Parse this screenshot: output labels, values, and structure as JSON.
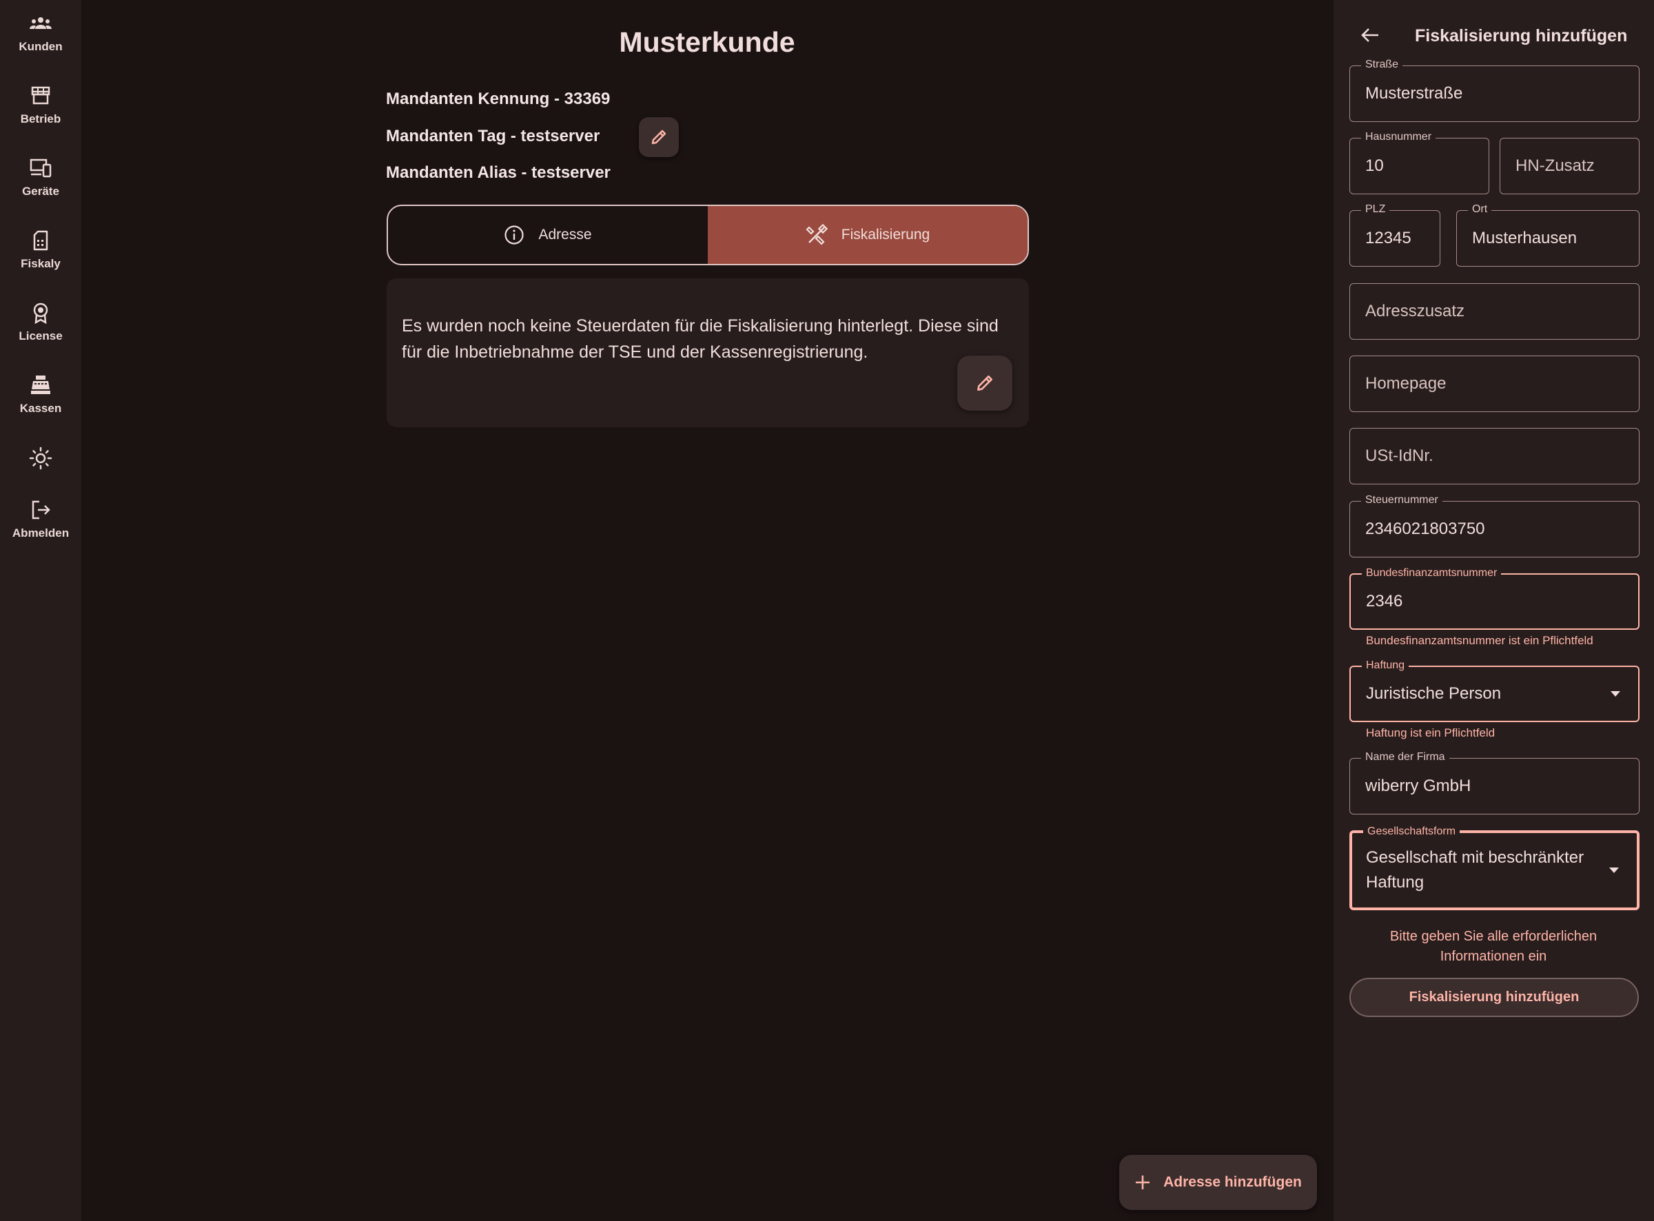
{
  "nav": {
    "items": [
      {
        "label": "Kunden",
        "icon": "customers-icon"
      },
      {
        "label": "Betrieb",
        "icon": "store-icon"
      },
      {
        "label": "Geräte",
        "icon": "devices-icon"
      },
      {
        "label": "Fiskaly",
        "icon": "sim-card-icon"
      },
      {
        "label": "License",
        "icon": "license-badge-icon"
      },
      {
        "label": "Kassen",
        "icon": "cash-register-icon"
      }
    ],
    "theme_icon": "sun-icon",
    "logout": {
      "label": "Abmelden",
      "icon": "logout-icon"
    }
  },
  "main": {
    "title": "Musterkunde",
    "kennung": "Mandanten Kennung - 33369",
    "tag": "Mandanten Tag - testserver",
    "alias": "Mandanten Alias - testserver",
    "tabs": [
      {
        "label": "Adresse",
        "icon": "info-icon",
        "active": false
      },
      {
        "label": "Fiskalisierung",
        "icon": "tools-icon",
        "active": true
      }
    ],
    "card_text": "Es wurden noch keine Steuerdaten für die Fiskalisierung hinterlegt. Diese sind für die Inbetriebnahme der TSE und der Kassenregistrierung.",
    "fab_label": "Adresse hinzufügen"
  },
  "panel": {
    "title": "Fiskalisierung hinzufügen",
    "fields": {
      "strasse": {
        "label": "Straße",
        "value": "Musterstraße"
      },
      "hausnummer": {
        "label": "Hausnummer",
        "value": "10"
      },
      "hn_zusatz": {
        "placeholder": "HN-Zusatz"
      },
      "plz": {
        "label": "PLZ",
        "value": "12345"
      },
      "ort": {
        "label": "Ort",
        "value": "Musterhausen"
      },
      "adresszusatz": {
        "placeholder": "Adresszusatz"
      },
      "homepage": {
        "placeholder": "Homepage"
      },
      "ust_id": {
        "placeholder": "USt-IdNr."
      },
      "steuernummer": {
        "label": "Steuernummer",
        "value": "2346021803750"
      },
      "bundesfinanzamt": {
        "label": "Bundesfinanzamtsnummer",
        "value": "2346",
        "error": "Bundesfinanzamtsnummer ist ein Pflichtfeld"
      },
      "haftung": {
        "label": "Haftung",
        "value": "Juristische Person",
        "error": "Haftung ist ein Pflichtfeld"
      },
      "firma": {
        "label": "Name der Firma",
        "value": "wiberry GmbH"
      },
      "gesellschaftsform": {
        "label": "Gesellschaftsform",
        "value": "Gesellschaft mit beschränkter Haftung"
      }
    },
    "form_message": "Bitte geben Sie alle erforderlichen Informationen ein",
    "submit_label": "Fiskalisierung hinzufügen"
  },
  "colors": {
    "background": "#1b1212",
    "rail": "#251c1b",
    "panel": "#271d1c",
    "accent": "#ffb4a8",
    "active_tab": "#9a4a3e"
  }
}
